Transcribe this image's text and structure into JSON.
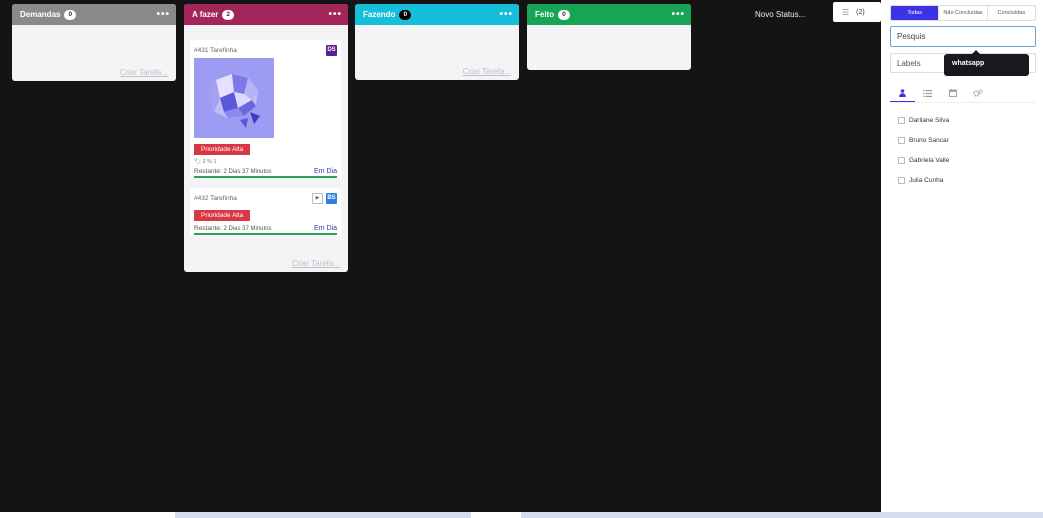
{
  "columns": [
    {
      "title": "Demandas",
      "count": "0",
      "color": "#8a8a8a",
      "create_label": "Criar Tarefa..."
    },
    {
      "title": "A fazer",
      "count": "2",
      "color": "#a3265a",
      "create_label": "Criar Tarefa..."
    },
    {
      "title": "Fazendo",
      "count": "0",
      "color": "#16bfd9",
      "create_label": "Criar Tarefa..."
    },
    {
      "title": "Feito",
      "count": "0",
      "color": "#17a555"
    }
  ],
  "menu_glyph": "•••",
  "cards": [
    {
      "id_label": "#431 Tarefinha",
      "avatar": "DS",
      "avatar_color": "#5e1c99",
      "priority": "Prioridade Alta",
      "meta": "3 % 1",
      "remaining_prefix": "Restante:",
      "remaining_value": "2 Dias 37 Minutos",
      "status": "Em Dia",
      "progress": 1.0
    },
    {
      "id_label": "#432 Tarefinha",
      "avatar": "BS",
      "avatar_color": "#2f7fde",
      "priority": "Prioridade Alta",
      "remaining_prefix": "Restante:",
      "remaining_value": "2 Dias 37 Minutos",
      "status": "Em Dia",
      "progress": 1.0
    }
  ],
  "novo_status": "Novo Status...",
  "panel_tab": {
    "count": "(2)"
  },
  "side_panel": {
    "filters": [
      "Todas",
      "Não Concluídas",
      "Concluídas"
    ],
    "search_value": "Pesquis",
    "labels_placeholder": "Labels",
    "tooltip": "whatsapp",
    "icon_tabs": [
      "user-icon",
      "list-icon",
      "calendar-icon",
      "gears-icon"
    ],
    "users": [
      "Darliane Silva",
      "Bruno Sancar",
      "Gabriela Valle",
      "Julia Cunha"
    ]
  }
}
